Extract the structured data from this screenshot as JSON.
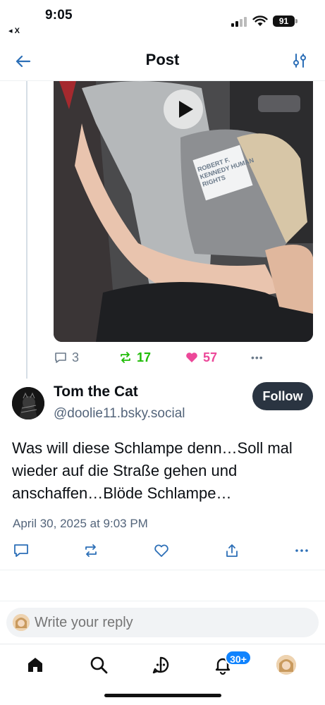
{
  "status_bar": {
    "time": "9:05",
    "back_app": "◂ X",
    "battery": "91"
  },
  "header": {
    "title": "Post"
  },
  "parent_post": {
    "video_bag_text": "ROBERT F. KENNEDY HUMAN RIGHTS",
    "replies": "3",
    "reposts": "17",
    "likes": "57",
    "more": "•••"
  },
  "main_post": {
    "display_name": "Tom the Cat",
    "handle": "@doolie11.bsky.social",
    "follow_label": "Follow",
    "text": "Was will diese Schlampe denn…Soll mal wieder auf die Straße gehen und anschaffen…Blöde Schlampe…",
    "date": "April 30, 2025 at 9:03 PM"
  },
  "composer": {
    "placeholder": "Write your reply"
  },
  "bottom_nav": {
    "notifications_badge": "30+"
  },
  "colors": {
    "accent_blue": "#1083fe",
    "repost_green": "#20bc07",
    "like_pink": "#ec4899",
    "muted": "#53647a",
    "follow_bg": "#2a3441"
  }
}
